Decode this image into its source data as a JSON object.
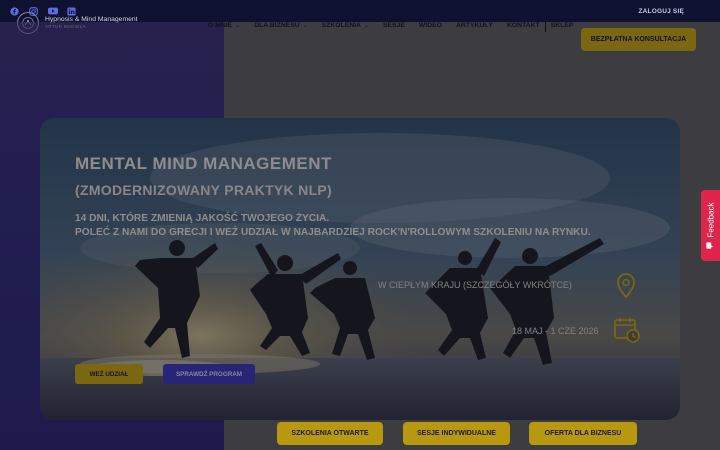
{
  "topbar": {
    "social_icons": [
      "facebook-icon",
      "instagram-icon",
      "youtube-icon",
      "linkedin-icon"
    ],
    "login_label": "ZALOGUJ SIĘ"
  },
  "logo": {
    "line1": "Hypnosis & Mind Management",
    "line2": "ARTUR MAKIEŁA"
  },
  "nav": {
    "items": [
      {
        "label": "O MNIE",
        "dropdown": true
      },
      {
        "label": "DLA BIZNESU",
        "dropdown": true
      },
      {
        "label": "SZKOLENIA",
        "dropdown": true
      },
      {
        "label": "SESJE",
        "dropdown": false
      },
      {
        "label": "WIDEO",
        "dropdown": false
      },
      {
        "label": "ARTYKUŁY",
        "dropdown": false
      },
      {
        "label": "KONTAKT",
        "dropdown": false
      }
    ],
    "shop_label": "SKLEP",
    "cta_label": "BEZPŁATNA KONSULTACJA"
  },
  "hero": {
    "title": "MENTAL MIND MANAGEMENT",
    "subtitle": "(ZMODERNIZOWANY PRAKTYK NLP)",
    "line1": "14 DNI, KTÓRE ZMIENIĄ JAKOŚĆ TWOJEGO ŻYCIA.",
    "line2": "POLEĆ Z NAMI DO GRECJI I WEŹ UDZIAŁ W NAJBARDZIEJ ROCK'N'ROLLOWYM SZKOLENIU NA RYNKU.",
    "location": "W CIEPŁYM KRAJU (SZCZEGÓŁY WKRÓTCE)",
    "dates": "18 MAJ - 1 CZE 2026",
    "join_label": "WEŹ UDZIAŁ",
    "program_label": "SPRAWDŹ PROGRAM"
  },
  "bottom": {
    "btn1": "SZKOLENIA OTWARTE",
    "btn2": "SESJE INDYWIDUALNE",
    "btn3": "OFERTA DLA BIZNESU"
  },
  "feedback_label": "Feedback",
  "colors": {
    "gold": "#b8980f",
    "purple": "#3b35a8",
    "navy": "#0f1130",
    "feedback": "#e0254d"
  }
}
